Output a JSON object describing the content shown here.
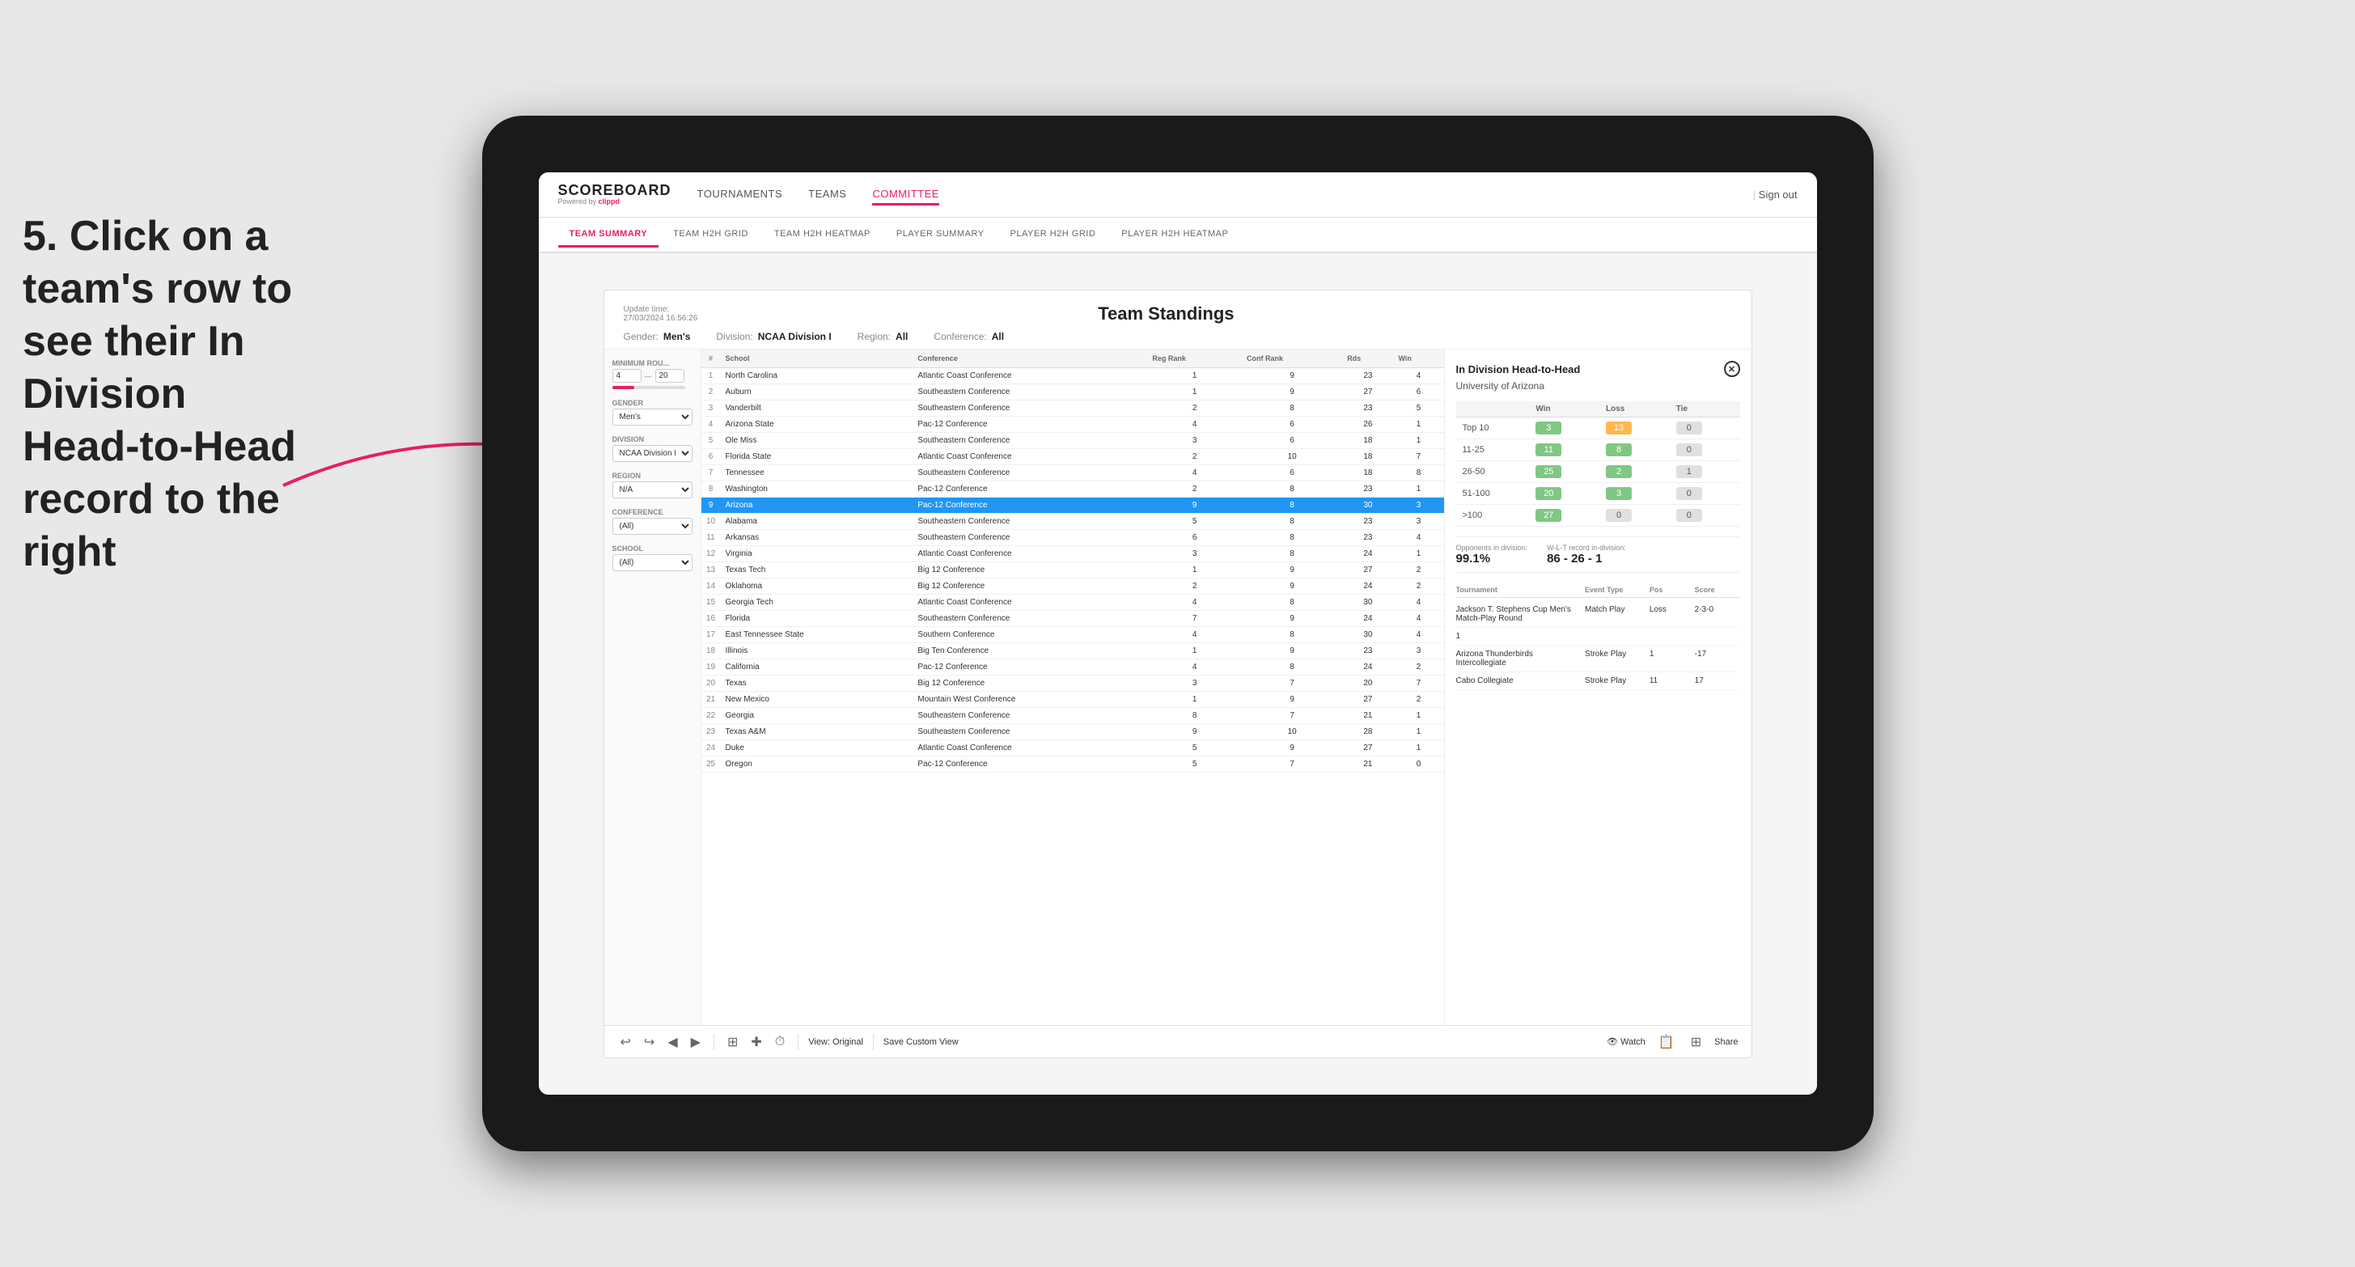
{
  "app": {
    "logo": "SCOREBOARD",
    "logo_sub": "Powered by clippd",
    "sign_out": "Sign out"
  },
  "nav": {
    "items": [
      {
        "label": "TOURNAMENTS",
        "active": false
      },
      {
        "label": "TEAMS",
        "active": false
      },
      {
        "label": "COMMITTEE",
        "active": true
      }
    ]
  },
  "sub_nav": {
    "items": [
      {
        "label": "TEAM SUMMARY",
        "active": true
      },
      {
        "label": "TEAM H2H GRID",
        "active": false
      },
      {
        "label": "TEAM H2H HEATMAP",
        "active": false
      },
      {
        "label": "PLAYER SUMMARY",
        "active": false
      },
      {
        "label": "PLAYER H2H GRID",
        "active": false
      },
      {
        "label": "PLAYER H2H HEATMAP",
        "active": false
      }
    ]
  },
  "card": {
    "update_time": "Update time:",
    "update_date": "27/03/2024 16:56:26",
    "title": "Team Standings",
    "gender_label": "Gender:",
    "gender_value": "Men's",
    "division_label": "Division:",
    "division_value": "NCAA Division I",
    "region_label": "Region:",
    "region_value": "All",
    "conference_label": "Conference:",
    "conference_value": "All"
  },
  "filters": {
    "min_rounds_label": "Minimum Rou...",
    "min_rounds_value": "4",
    "min_rounds_max": "20",
    "gender_label": "Gender",
    "gender_value": "Men's",
    "division_label": "Division",
    "division_value": "NCAA Division I",
    "region_label": "Region",
    "region_value": "N/A",
    "conference_label": "Conference",
    "conference_value": "(All)",
    "school_label": "School",
    "school_value": "(All)"
  },
  "table": {
    "headers": [
      "#",
      "School",
      "Conference",
      "Reg Rank",
      "Conf Rank",
      "Rds",
      "Win"
    ],
    "rows": [
      {
        "rank": 1,
        "school": "North Carolina",
        "conference": "Atlantic Coast Conference",
        "reg_rank": 1,
        "conf_rank": 9,
        "rds": 23,
        "win": 4
      },
      {
        "rank": 2,
        "school": "Auburn",
        "conference": "Southeastern Conference",
        "reg_rank": 1,
        "conf_rank": 9,
        "rds": 27,
        "win": 6
      },
      {
        "rank": 3,
        "school": "Vanderbilt",
        "conference": "Southeastern Conference",
        "reg_rank": 2,
        "conf_rank": 8,
        "rds": 23,
        "win": 5
      },
      {
        "rank": 4,
        "school": "Arizona State",
        "conference": "Pac-12 Conference",
        "reg_rank": 4,
        "conf_rank": 6,
        "rds": 26,
        "win": 1
      },
      {
        "rank": 5,
        "school": "Ole Miss",
        "conference": "Southeastern Conference",
        "reg_rank": 3,
        "conf_rank": 6,
        "rds": 18,
        "win": 1
      },
      {
        "rank": 6,
        "school": "Florida State",
        "conference": "Atlantic Coast Conference",
        "reg_rank": 2,
        "conf_rank": 10,
        "rds": 18,
        "win": 7
      },
      {
        "rank": 7,
        "school": "Tennessee",
        "conference": "Southeastern Conference",
        "reg_rank": 4,
        "conf_rank": 6,
        "rds": 18,
        "win": 8
      },
      {
        "rank": 8,
        "school": "Washington",
        "conference": "Pac-12 Conference",
        "reg_rank": 2,
        "conf_rank": 8,
        "rds": 23,
        "win": 1
      },
      {
        "rank": 9,
        "school": "Arizona",
        "conference": "Pac-12 Conference",
        "reg_rank": 9,
        "conf_rank": 8,
        "rds": 30,
        "win": 3,
        "selected": true
      },
      {
        "rank": 10,
        "school": "Alabama",
        "conference": "Southeastern Conference",
        "reg_rank": 5,
        "conf_rank": 8,
        "rds": 23,
        "win": 3
      },
      {
        "rank": 11,
        "school": "Arkansas",
        "conference": "Southeastern Conference",
        "reg_rank": 6,
        "conf_rank": 8,
        "rds": 23,
        "win": 4
      },
      {
        "rank": 12,
        "school": "Virginia",
        "conference": "Atlantic Coast Conference",
        "reg_rank": 3,
        "conf_rank": 8,
        "rds": 24,
        "win": 1
      },
      {
        "rank": 13,
        "school": "Texas Tech",
        "conference": "Big 12 Conference",
        "reg_rank": 1,
        "conf_rank": 9,
        "rds": 27,
        "win": 2
      },
      {
        "rank": 14,
        "school": "Oklahoma",
        "conference": "Big 12 Conference",
        "reg_rank": 2,
        "conf_rank": 9,
        "rds": 24,
        "win": 2
      },
      {
        "rank": 15,
        "school": "Georgia Tech",
        "conference": "Atlantic Coast Conference",
        "reg_rank": 4,
        "conf_rank": 8,
        "rds": 30,
        "win": 4
      },
      {
        "rank": 16,
        "school": "Florida",
        "conference": "Southeastern Conference",
        "reg_rank": 7,
        "conf_rank": 9,
        "rds": 24,
        "win": 4
      },
      {
        "rank": 17,
        "school": "East Tennessee State",
        "conference": "Southern Conference",
        "reg_rank": 4,
        "conf_rank": 8,
        "rds": 30,
        "win": 4
      },
      {
        "rank": 18,
        "school": "Illinois",
        "conference": "Big Ten Conference",
        "reg_rank": 1,
        "conf_rank": 9,
        "rds": 23,
        "win": 3
      },
      {
        "rank": 19,
        "school": "California",
        "conference": "Pac-12 Conference",
        "reg_rank": 4,
        "conf_rank": 8,
        "rds": 24,
        "win": 2
      },
      {
        "rank": 20,
        "school": "Texas",
        "conference": "Big 12 Conference",
        "reg_rank": 3,
        "conf_rank": 7,
        "rds": 20,
        "win": 7
      },
      {
        "rank": 21,
        "school": "New Mexico",
        "conference": "Mountain West Conference",
        "reg_rank": 1,
        "conf_rank": 9,
        "rds": 27,
        "win": 2
      },
      {
        "rank": 22,
        "school": "Georgia",
        "conference": "Southeastern Conference",
        "reg_rank": 8,
        "conf_rank": 7,
        "rds": 21,
        "win": 1
      },
      {
        "rank": 23,
        "school": "Texas A&M",
        "conference": "Southeastern Conference",
        "reg_rank": 9,
        "conf_rank": 10,
        "rds": 28,
        "win": 1
      },
      {
        "rank": 24,
        "school": "Duke",
        "conference": "Atlantic Coast Conference",
        "reg_rank": 5,
        "conf_rank": 9,
        "rds": 27,
        "win": 1
      },
      {
        "rank": 25,
        "school": "Oregon",
        "conference": "Pac-12 Conference",
        "reg_rank": 5,
        "conf_rank": 7,
        "rds": 21,
        "win": 0
      }
    ]
  },
  "right_panel": {
    "title": "In Division Head-to-Head",
    "team_name": "University of Arizona",
    "h2h_headers": [
      "",
      "Win",
      "Loss",
      "Tie"
    ],
    "h2h_rows": [
      {
        "label": "Top 10",
        "win": 3,
        "loss": 13,
        "tie": 0,
        "win_color": "green",
        "loss_color": "orange"
      },
      {
        "label": "11-25",
        "win": 11,
        "loss": 8,
        "tie": 0,
        "win_color": "green",
        "loss_color": "green"
      },
      {
        "label": "26-50",
        "win": 25,
        "loss": 2,
        "tie": 1,
        "win_color": "green",
        "loss_color": "green"
      },
      {
        "label": "51-100",
        "win": 20,
        "loss": 3,
        "tie": 0,
        "win_color": "green",
        "loss_color": "green"
      },
      {
        "label": ">100",
        "win": 27,
        "loss": 0,
        "tie": 0,
        "win_color": "green",
        "loss_color": "gray"
      }
    ],
    "opponents_label": "Opponents in division:",
    "opponents_value": "99.1%",
    "record_label": "W-L-T record in-division:",
    "record_value": "86 - 26 - 1",
    "tournament_headers": [
      "Tournament",
      "Event Type",
      "Pos",
      "Score"
    ],
    "tournament_rows": [
      {
        "name": "Jackson T. Stephens Cup Men's Match-Play Round",
        "type": "Match Play",
        "pos": "Loss",
        "score": "2-3-0"
      },
      {
        "name": "1",
        "type": "",
        "pos": "",
        "score": ""
      },
      {
        "name": "Arizona Thunderbirds Intercollegiate",
        "type": "Stroke Play",
        "pos": "1",
        "score": "-17"
      },
      {
        "name": "Cabo Collegiate",
        "type": "Stroke Play",
        "pos": "11",
        "score": "17"
      }
    ]
  },
  "toolbar": {
    "undo": "↩",
    "redo": "↪",
    "prev": "◀",
    "next": "▶",
    "camera": "📷",
    "clock": "⏱",
    "view_original": "View: Original",
    "save_custom": "Save Custom View",
    "watch": "👁 Watch",
    "share": "Share"
  },
  "annotation": {
    "text": "5. Click on a team's row to see their In Division Head-to-Head record to the right"
  }
}
